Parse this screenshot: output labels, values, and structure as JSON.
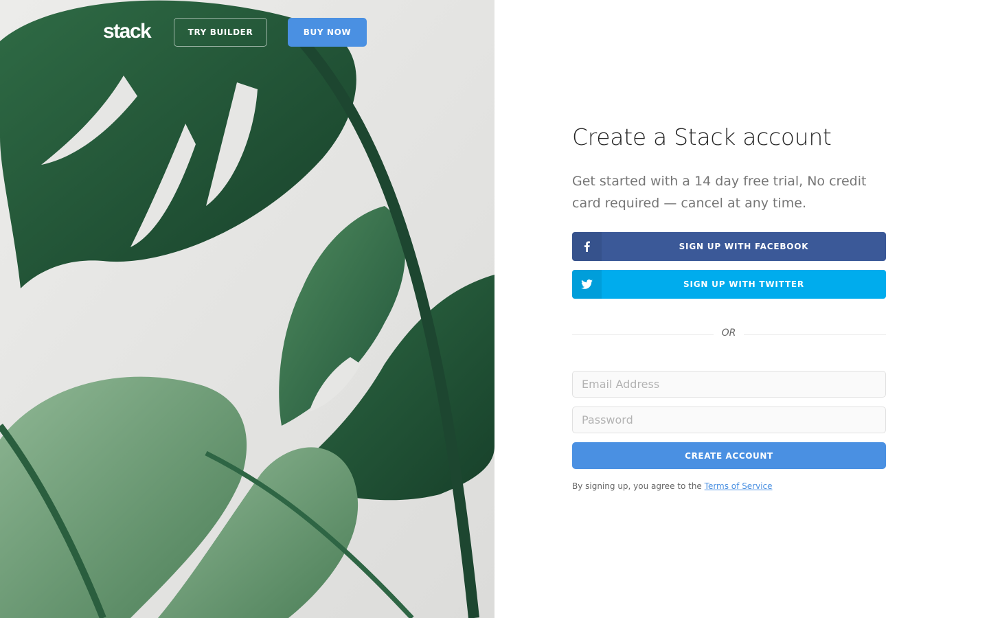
{
  "header": {
    "logo_text": "stack",
    "try_builder_label": "TRY BUILDER",
    "buy_now_label": "BUY NOW"
  },
  "hero_image": {
    "subject": "monstera leaves",
    "icon": "plant-photo"
  },
  "form": {
    "title": "Create a Stack account",
    "lead": "Get started with a 14 day free trial, No credit card required — cancel at any time.",
    "facebook_label": "SIGN UP WITH FACEBOOK",
    "facebook_icon": "facebook-icon",
    "twitter_label": "SIGN UP WITH TWITTER",
    "twitter_icon": "twitter-icon",
    "divider_text": "OR",
    "email_placeholder": "Email Address",
    "password_placeholder": "Password",
    "submit_label": "CREATE ACCOUNT",
    "terms_prefix": "By signing up, you agree to the",
    "terms_link": "Terms of Service"
  },
  "colors": {
    "accent": "#4a90e2",
    "facebook": "#3b5998",
    "twitter": "#00aced",
    "heading": "#252525",
    "muted_text": "#767676"
  }
}
